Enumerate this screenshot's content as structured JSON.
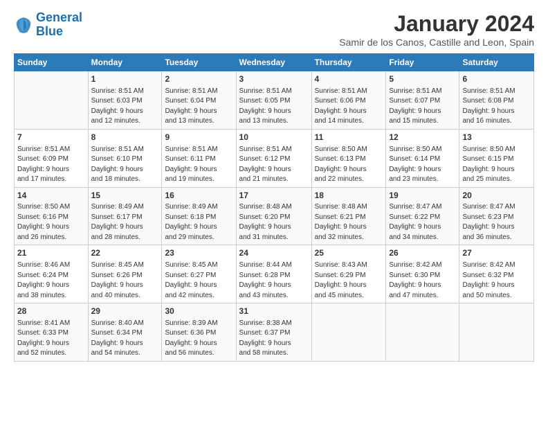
{
  "logo": {
    "line1": "General",
    "line2": "Blue"
  },
  "title": "January 2024",
  "subtitle": "Samir de los Canos, Castille and Leon, Spain",
  "headers": [
    "Sunday",
    "Monday",
    "Tuesday",
    "Wednesday",
    "Thursday",
    "Friday",
    "Saturday"
  ],
  "weeks": [
    [
      {
        "day": "",
        "info": ""
      },
      {
        "day": "1",
        "info": "Sunrise: 8:51 AM\nSunset: 6:03 PM\nDaylight: 9 hours\nand 12 minutes."
      },
      {
        "day": "2",
        "info": "Sunrise: 8:51 AM\nSunset: 6:04 PM\nDaylight: 9 hours\nand 13 minutes."
      },
      {
        "day": "3",
        "info": "Sunrise: 8:51 AM\nSunset: 6:05 PM\nDaylight: 9 hours\nand 13 minutes."
      },
      {
        "day": "4",
        "info": "Sunrise: 8:51 AM\nSunset: 6:06 PM\nDaylight: 9 hours\nand 14 minutes."
      },
      {
        "day": "5",
        "info": "Sunrise: 8:51 AM\nSunset: 6:07 PM\nDaylight: 9 hours\nand 15 minutes."
      },
      {
        "day": "6",
        "info": "Sunrise: 8:51 AM\nSunset: 6:08 PM\nDaylight: 9 hours\nand 16 minutes."
      }
    ],
    [
      {
        "day": "7",
        "info": "Sunrise: 8:51 AM\nSunset: 6:09 PM\nDaylight: 9 hours\nand 17 minutes."
      },
      {
        "day": "8",
        "info": "Sunrise: 8:51 AM\nSunset: 6:10 PM\nDaylight: 9 hours\nand 18 minutes."
      },
      {
        "day": "9",
        "info": "Sunrise: 8:51 AM\nSunset: 6:11 PM\nDaylight: 9 hours\nand 19 minutes."
      },
      {
        "day": "10",
        "info": "Sunrise: 8:51 AM\nSunset: 6:12 PM\nDaylight: 9 hours\nand 21 minutes."
      },
      {
        "day": "11",
        "info": "Sunrise: 8:50 AM\nSunset: 6:13 PM\nDaylight: 9 hours\nand 22 minutes."
      },
      {
        "day": "12",
        "info": "Sunrise: 8:50 AM\nSunset: 6:14 PM\nDaylight: 9 hours\nand 23 minutes."
      },
      {
        "day": "13",
        "info": "Sunrise: 8:50 AM\nSunset: 6:15 PM\nDaylight: 9 hours\nand 25 minutes."
      }
    ],
    [
      {
        "day": "14",
        "info": "Sunrise: 8:50 AM\nSunset: 6:16 PM\nDaylight: 9 hours\nand 26 minutes."
      },
      {
        "day": "15",
        "info": "Sunrise: 8:49 AM\nSunset: 6:17 PM\nDaylight: 9 hours\nand 28 minutes."
      },
      {
        "day": "16",
        "info": "Sunrise: 8:49 AM\nSunset: 6:18 PM\nDaylight: 9 hours\nand 29 minutes."
      },
      {
        "day": "17",
        "info": "Sunrise: 8:48 AM\nSunset: 6:20 PM\nDaylight: 9 hours\nand 31 minutes."
      },
      {
        "day": "18",
        "info": "Sunrise: 8:48 AM\nSunset: 6:21 PM\nDaylight: 9 hours\nand 32 minutes."
      },
      {
        "day": "19",
        "info": "Sunrise: 8:47 AM\nSunset: 6:22 PM\nDaylight: 9 hours\nand 34 minutes."
      },
      {
        "day": "20",
        "info": "Sunrise: 8:47 AM\nSunset: 6:23 PM\nDaylight: 9 hours\nand 36 minutes."
      }
    ],
    [
      {
        "day": "21",
        "info": "Sunrise: 8:46 AM\nSunset: 6:24 PM\nDaylight: 9 hours\nand 38 minutes."
      },
      {
        "day": "22",
        "info": "Sunrise: 8:45 AM\nSunset: 6:26 PM\nDaylight: 9 hours\nand 40 minutes."
      },
      {
        "day": "23",
        "info": "Sunrise: 8:45 AM\nSunset: 6:27 PM\nDaylight: 9 hours\nand 42 minutes."
      },
      {
        "day": "24",
        "info": "Sunrise: 8:44 AM\nSunset: 6:28 PM\nDaylight: 9 hours\nand 43 minutes."
      },
      {
        "day": "25",
        "info": "Sunrise: 8:43 AM\nSunset: 6:29 PM\nDaylight: 9 hours\nand 45 minutes."
      },
      {
        "day": "26",
        "info": "Sunrise: 8:42 AM\nSunset: 6:30 PM\nDaylight: 9 hours\nand 47 minutes."
      },
      {
        "day": "27",
        "info": "Sunrise: 8:42 AM\nSunset: 6:32 PM\nDaylight: 9 hours\nand 50 minutes."
      }
    ],
    [
      {
        "day": "28",
        "info": "Sunrise: 8:41 AM\nSunset: 6:33 PM\nDaylight: 9 hours\nand 52 minutes."
      },
      {
        "day": "29",
        "info": "Sunrise: 8:40 AM\nSunset: 6:34 PM\nDaylight: 9 hours\nand 54 minutes."
      },
      {
        "day": "30",
        "info": "Sunrise: 8:39 AM\nSunset: 6:36 PM\nDaylight: 9 hours\nand 56 minutes."
      },
      {
        "day": "31",
        "info": "Sunrise: 8:38 AM\nSunset: 6:37 PM\nDaylight: 9 hours\nand 58 minutes."
      },
      {
        "day": "",
        "info": ""
      },
      {
        "day": "",
        "info": ""
      },
      {
        "day": "",
        "info": ""
      }
    ]
  ]
}
